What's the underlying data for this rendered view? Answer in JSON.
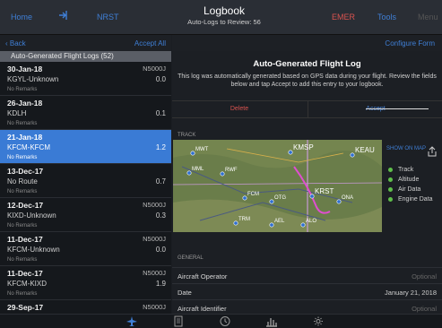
{
  "topbar": {
    "home": "Home",
    "signin_icon": "sign-in-icon",
    "nrst": "NRST",
    "title": "Logbook",
    "subtitle": "Auto-Logs to Review: 56",
    "emer": "EMER",
    "tools": "Tools",
    "menu": "Menu"
  },
  "left": {
    "back": "Back",
    "accept_all": "Accept All",
    "section_title": "Auto-Generated Flight Logs (52)",
    "rows": [
      {
        "date": "30-Jan-18",
        "tail": "N5000J",
        "route": "KGYL-Unknown",
        "time": "0.0",
        "remarks": "No Remarks",
        "selected": false
      },
      {
        "date": "26-Jan-18",
        "tail": "",
        "route": "KDLH",
        "time": "0.1",
        "remarks": "No Remarks",
        "selected": false
      },
      {
        "date": "21-Jan-18",
        "tail": "",
        "route": "KFCM-KFCM",
        "time": "1.2",
        "remarks": "No Remarks",
        "selected": true
      },
      {
        "date": "13-Dec-17",
        "tail": "",
        "route": "No Route",
        "time": "0.7",
        "remarks": "No Remarks",
        "selected": false
      },
      {
        "date": "12-Dec-17",
        "tail": "N5000J",
        "route": "KIXD-Unknown",
        "time": "0.3",
        "remarks": "No Remarks",
        "selected": false
      },
      {
        "date": "11-Dec-17",
        "tail": "N5000J",
        "route": "KFCM-Unknown",
        "time": "0.0",
        "remarks": "No Remarks",
        "selected": false
      },
      {
        "date": "11-Dec-17",
        "tail": "N5000J",
        "route": "KFCM-KIXD",
        "time": "1.9",
        "remarks": "No Remarks",
        "selected": false
      },
      {
        "date": "29-Sep-17",
        "tail": "N5000J",
        "route": "",
        "time": "",
        "remarks": "",
        "selected": false
      }
    ]
  },
  "right": {
    "configure_form": "Configure Form",
    "auto_title": "Auto-Generated Flight Log",
    "auto_message": "This log was automatically generated based on GPS data during your flight. Review the fields below and tap Accept to add this entry to your logbook.",
    "delete": "Delete",
    "accept": "Accept",
    "track_label": "TRACK",
    "show_on_map": "SHOW ON MAP",
    "legend": [
      "Track",
      "Altitude",
      "Air Data",
      "Engine Data"
    ],
    "legend_color": "#5fbf4a",
    "map_labels": [
      "MWT",
      "KMSP",
      "KEAU",
      "RWF",
      "MML",
      "KRST",
      "ONA",
      "FCM",
      "OTG",
      "TRM",
      "AEL",
      "ALO"
    ],
    "general_label": "GENERAL",
    "fields": [
      {
        "key": "Aircraft Operator",
        "value": "Optional",
        "placeholder": true
      },
      {
        "key": "Date",
        "value": "January 21, 2018",
        "placeholder": false
      },
      {
        "key": "Aircraft Identifier",
        "value": "Optional",
        "placeholder": true
      }
    ]
  },
  "tabbar": {
    "icons": [
      "airplane-icon",
      "document-icon",
      "clock-icon",
      "bar-chart-icon",
      "gear-icon"
    ]
  },
  "colors": {
    "accent": "#3f7fd6",
    "selected_row": "#3a7bd5",
    "delete": "#d9534f",
    "emer": "#d9534f"
  }
}
